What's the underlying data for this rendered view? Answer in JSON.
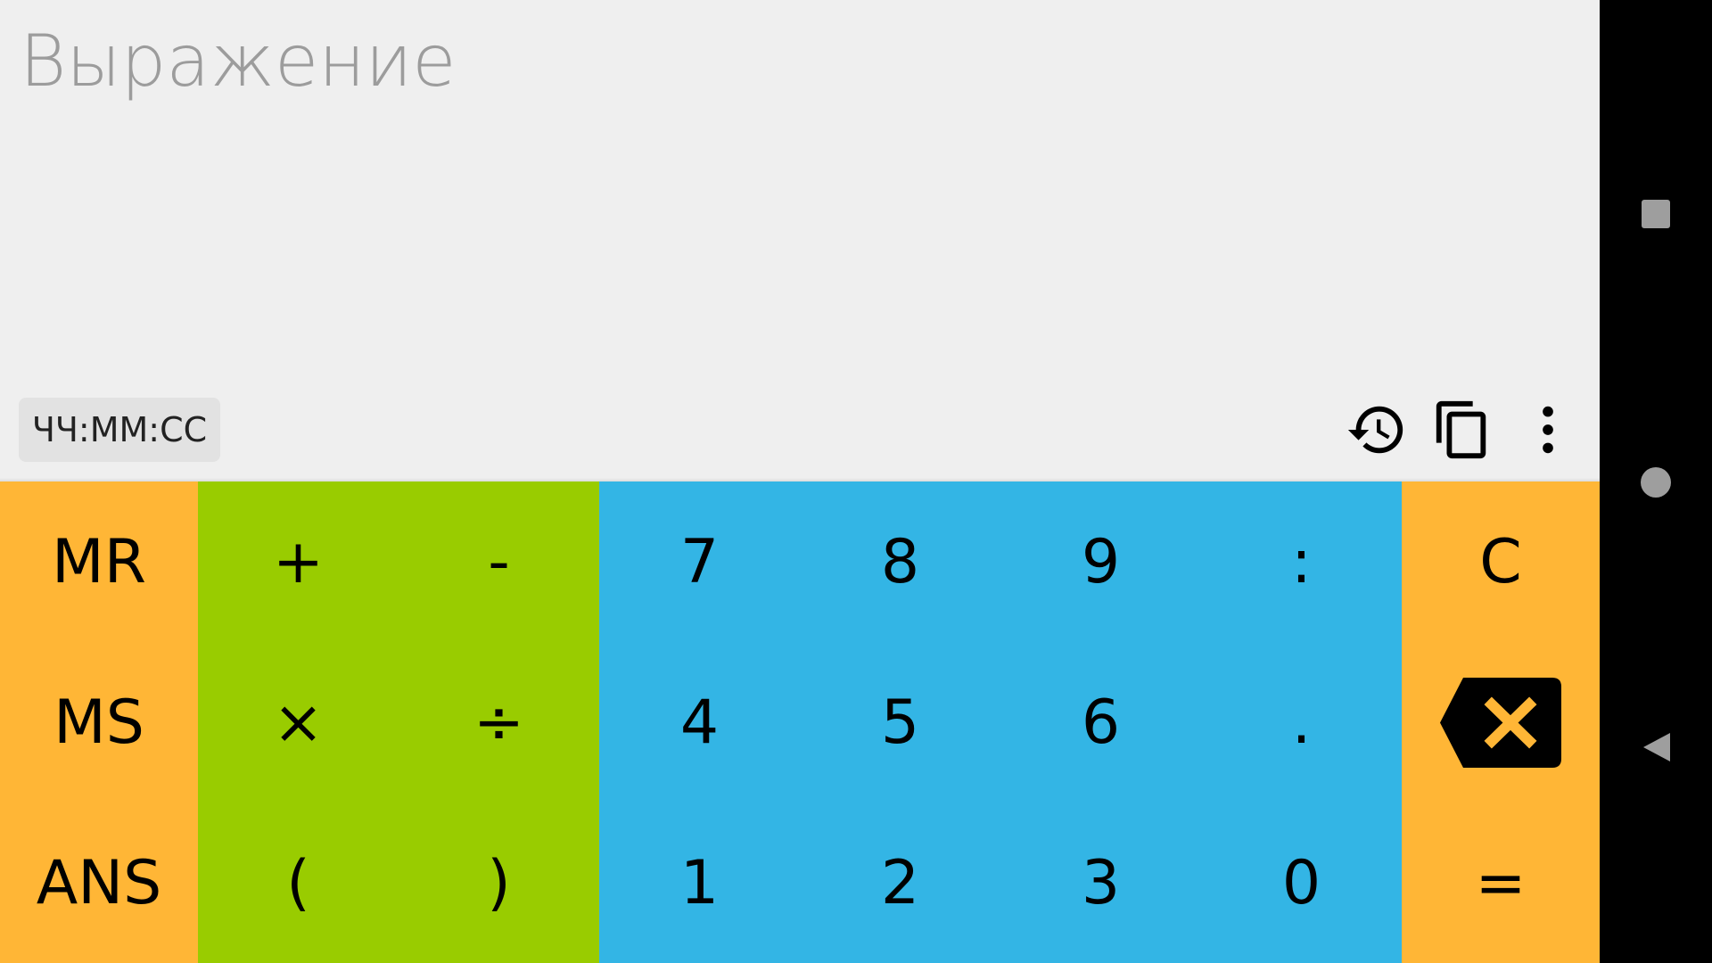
{
  "display": {
    "expression_placeholder": "Выражение",
    "time_format": "ЧЧ:ММ:СС"
  },
  "toolbar": {
    "icons": [
      "history-icon",
      "copy-icon",
      "more-vert-icon"
    ]
  },
  "keypad": {
    "memory": [
      "MR",
      "MS",
      "ANS"
    ],
    "operators": [
      [
        "+",
        "-"
      ],
      [
        "×",
        "÷"
      ],
      [
        "(",
        ")"
      ]
    ],
    "digits": [
      [
        "7",
        "8",
        "9",
        ":"
      ],
      [
        "4",
        "5",
        "6",
        "."
      ],
      [
        "1",
        "2",
        "3",
        "0"
      ]
    ],
    "actions": {
      "clear": "C",
      "backspace_icon": "backspace-icon",
      "equals": "="
    }
  },
  "colors": {
    "orange": "#ffb636",
    "green": "#99cc00",
    "blue": "#33b5e5",
    "display_bg": "#efefef",
    "placeholder": "#9c9c9c",
    "nav_bar": "#000000"
  },
  "system_nav": {
    "icons": [
      "recents-square-icon",
      "home-circle-icon",
      "back-triangle-icon"
    ]
  }
}
